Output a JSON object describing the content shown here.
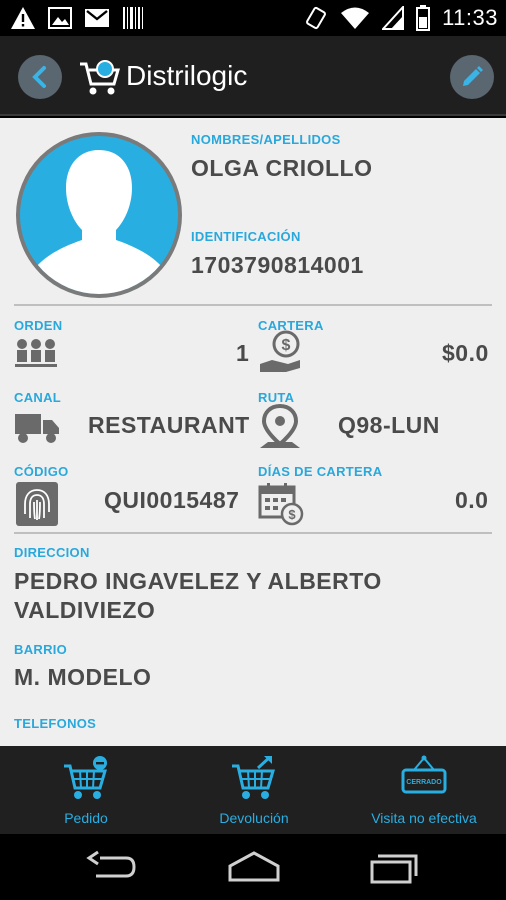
{
  "status_bar": {
    "time": "11:33",
    "icons": [
      "warning-icon",
      "image-icon",
      "gmail-icon",
      "barcode-icon",
      "vibrate-icon",
      "wifi-icon",
      "signal-icon",
      "battery-icon"
    ]
  },
  "app_bar": {
    "title": "Distrilogic",
    "icons": [
      "back-icon",
      "cart-logo-icon",
      "edit-icon"
    ]
  },
  "client": {
    "name_label": "NOMBRES/APELLIDOS",
    "name": "OLGA CRIOLLO",
    "id_label": "IDENTIFICACIÓN",
    "id": "1703790814001",
    "orden_label": "ORDEN",
    "orden": "1",
    "cartera_label": "CARTERA",
    "cartera": "$0.0",
    "canal_label": "CANAL",
    "canal": "RESTAURANT",
    "ruta_label": "RUTA",
    "ruta": "Q98-LUN",
    "codigo_label": "CÓDIGO",
    "codigo": "QUI0015487",
    "dias_label": "DÍAS DE CARTERA",
    "dias": "0.0",
    "direccion_label": "DIRECCION",
    "direccion_line1": "PEDRO INGAVELEZ Y ALBERTO",
    "direccion_line2": "VALDIVIEZO",
    "barrio_label": "BARRIO",
    "barrio": "M. MODELO",
    "telefonos_label": "TELEFONOS"
  },
  "actions": [
    {
      "label": "Pedido",
      "icon": "cart-add-icon"
    },
    {
      "label": "Devolución",
      "icon": "cart-return-icon"
    },
    {
      "label": "Visita no efectiva",
      "icon": "closed-sign-icon",
      "sign_text": "CERRADO"
    }
  ],
  "nav": [
    "back-nav-icon",
    "home-nav-icon",
    "recents-nav-icon"
  ],
  "colors": {
    "accent": "#29aee2",
    "text": "#4a4a4a",
    "background": "#efefef",
    "app_bar": "#1f1f1f"
  }
}
